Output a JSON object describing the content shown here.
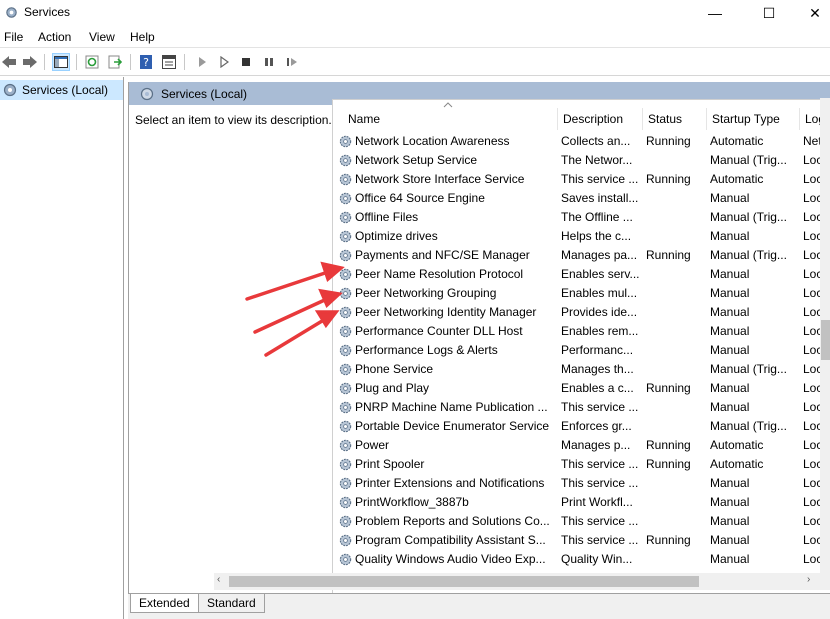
{
  "window": {
    "title": "Services",
    "minimize": "—",
    "maximize": "☐",
    "close": "✕"
  },
  "menu": {
    "file": "File",
    "action": "Action",
    "view": "View",
    "help": "Help"
  },
  "tree": {
    "root_label": "Services (Local)"
  },
  "panel": {
    "header": "Services (Local)",
    "description_hint": "Select an item to view its description."
  },
  "table": {
    "columns": {
      "name": "Name",
      "description": "Description",
      "status": "Status",
      "startup": "Startup Type",
      "logon": "Log"
    },
    "rows": [
      {
        "name": "Network Location Awareness",
        "description": "Collects an...",
        "status": "Running",
        "startup": "Automatic",
        "logon": "Net"
      },
      {
        "name": "Network Setup Service",
        "description": "The Networ...",
        "status": "",
        "startup": "Manual (Trig...",
        "logon": "Loc"
      },
      {
        "name": "Network Store Interface Service",
        "description": "This service ...",
        "status": "Running",
        "startup": "Automatic",
        "logon": "Loc"
      },
      {
        "name": "Office 64 Source Engine",
        "description": "Saves install...",
        "status": "",
        "startup": "Manual",
        "logon": "Loc"
      },
      {
        "name": "Offline Files",
        "description": "The Offline ...",
        "status": "",
        "startup": "Manual (Trig...",
        "logon": "Loc"
      },
      {
        "name": "Optimize drives",
        "description": "Helps the c...",
        "status": "",
        "startup": "Manual",
        "logon": "Loc"
      },
      {
        "name": "Payments and NFC/SE Manager",
        "description": "Manages pa...",
        "status": "Running",
        "startup": "Manual (Trig...",
        "logon": "Loc"
      },
      {
        "name": "Peer Name Resolution Protocol",
        "description": "Enables serv...",
        "status": "",
        "startup": "Manual",
        "logon": "Loc"
      },
      {
        "name": "Peer Networking Grouping",
        "description": "Enables mul...",
        "status": "",
        "startup": "Manual",
        "logon": "Loc"
      },
      {
        "name": "Peer Networking Identity Manager",
        "description": "Provides ide...",
        "status": "",
        "startup": "Manual",
        "logon": "Loc"
      },
      {
        "name": "Performance Counter DLL Host",
        "description": "Enables rem...",
        "status": "",
        "startup": "Manual",
        "logon": "Loc"
      },
      {
        "name": "Performance Logs & Alerts",
        "description": "Performanc...",
        "status": "",
        "startup": "Manual",
        "logon": "Loc"
      },
      {
        "name": "Phone Service",
        "description": "Manages th...",
        "status": "",
        "startup": "Manual (Trig...",
        "logon": "Loc"
      },
      {
        "name": "Plug and Play",
        "description": "Enables a c...",
        "status": "Running",
        "startup": "Manual",
        "logon": "Loc"
      },
      {
        "name": "PNRP Machine Name Publication ...",
        "description": "This service ...",
        "status": "",
        "startup": "Manual",
        "logon": "Loc"
      },
      {
        "name": "Portable Device Enumerator Service",
        "description": "Enforces gr...",
        "status": "",
        "startup": "Manual (Trig...",
        "logon": "Loc"
      },
      {
        "name": "Power",
        "description": "Manages p...",
        "status": "Running",
        "startup": "Automatic",
        "logon": "Loc"
      },
      {
        "name": "Print Spooler",
        "description": "This service ...",
        "status": "Running",
        "startup": "Automatic",
        "logon": "Loc"
      },
      {
        "name": "Printer Extensions and Notifications",
        "description": "This service ...",
        "status": "",
        "startup": "Manual",
        "logon": "Loc"
      },
      {
        "name": "PrintWorkflow_3887b",
        "description": "Print Workfl...",
        "status": "",
        "startup": "Manual",
        "logon": "Loc"
      },
      {
        "name": "Problem Reports and Solutions Co...",
        "description": "This service ...",
        "status": "",
        "startup": "Manual",
        "logon": "Loc"
      },
      {
        "name": "Program Compatibility Assistant S...",
        "description": "This service ...",
        "status": "Running",
        "startup": "Manual",
        "logon": "Loc"
      },
      {
        "name": "Quality Windows Audio Video Exp...",
        "description": "Quality Win...",
        "status": "",
        "startup": "Manual",
        "logon": "Loc"
      }
    ]
  },
  "tabs": {
    "extended": "Extended",
    "standard": "Standard"
  },
  "colors": {
    "header_band": "#a9bcd5",
    "selected": "#cce8ff",
    "arrow": "#e8393b"
  }
}
